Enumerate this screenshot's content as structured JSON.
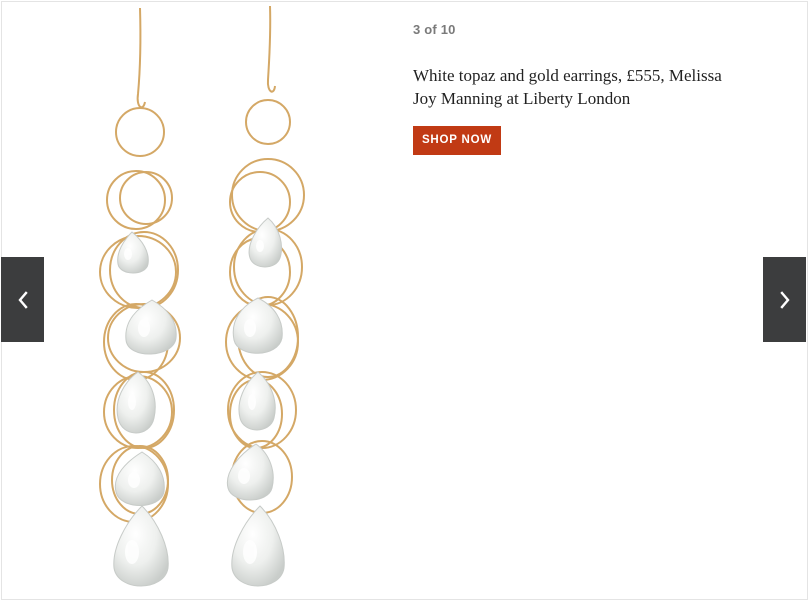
{
  "gallery": {
    "counter": "3 of 10",
    "caption": "White topaz and gold earrings, £555, Melissa Joy Manning at Liberty London",
    "shop_label": "SHOP NOW",
    "prev_icon": "chevron-left-icon",
    "next_icon": "chevron-right-icon"
  },
  "colors": {
    "button_bg": "#c13a14",
    "nav_bg": "#3c3d3e",
    "counter_text": "#7a7a7a",
    "gold": "#d4a866"
  }
}
